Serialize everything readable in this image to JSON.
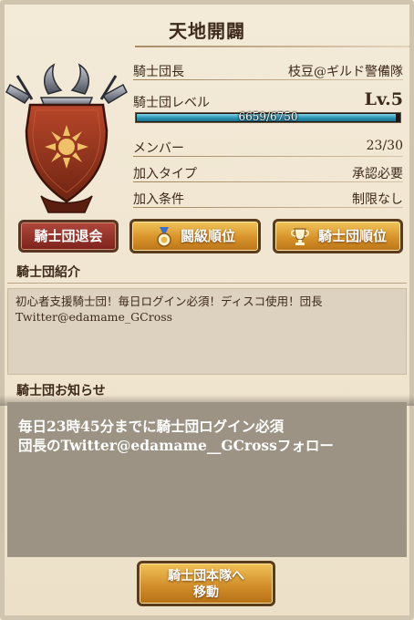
{
  "header": {
    "title": "天地開闢"
  },
  "info": {
    "leader_label": "騎士団長",
    "leader_value": "枝豆@ギルド警備隊",
    "level_label": "騎士団レベル",
    "level_value": "Lv.5",
    "xp_text": "6659/6750",
    "xp_progress": 0.9865,
    "members_label": "メンバー",
    "members_value": "23/30",
    "join_type_label": "加入タイプ",
    "join_type_value": "承認必要",
    "join_cond_label": "加入条件",
    "join_cond_value": "制限なし"
  },
  "buttons": {
    "leave": "騎士団退会",
    "rank_battle": "闘級順位",
    "rank_guild": "騎士団順位",
    "move": "騎士団本隊へ\n移動"
  },
  "intro": {
    "label": "騎士団紹介",
    "text": "初心者支援騎士団！毎日ログイン必須！ディスコ使用！団長Twitter@edamame_GCross"
  },
  "notice": {
    "label": "騎士団お知らせ",
    "text": "毎日23時45分までに騎士団ログイン必須\n団長のTwitter@edamame__GCrossフォロー"
  },
  "colors": {
    "emblem_red": "#9e3a22",
    "gold_button": "#d7932a",
    "leave_button": "#8c2a22",
    "xp_fill": "#2a93b4"
  },
  "icons": {
    "emblem": "guild-emblem-sun-shield",
    "medal": "medal-icon",
    "trophy": "trophy-icon"
  }
}
